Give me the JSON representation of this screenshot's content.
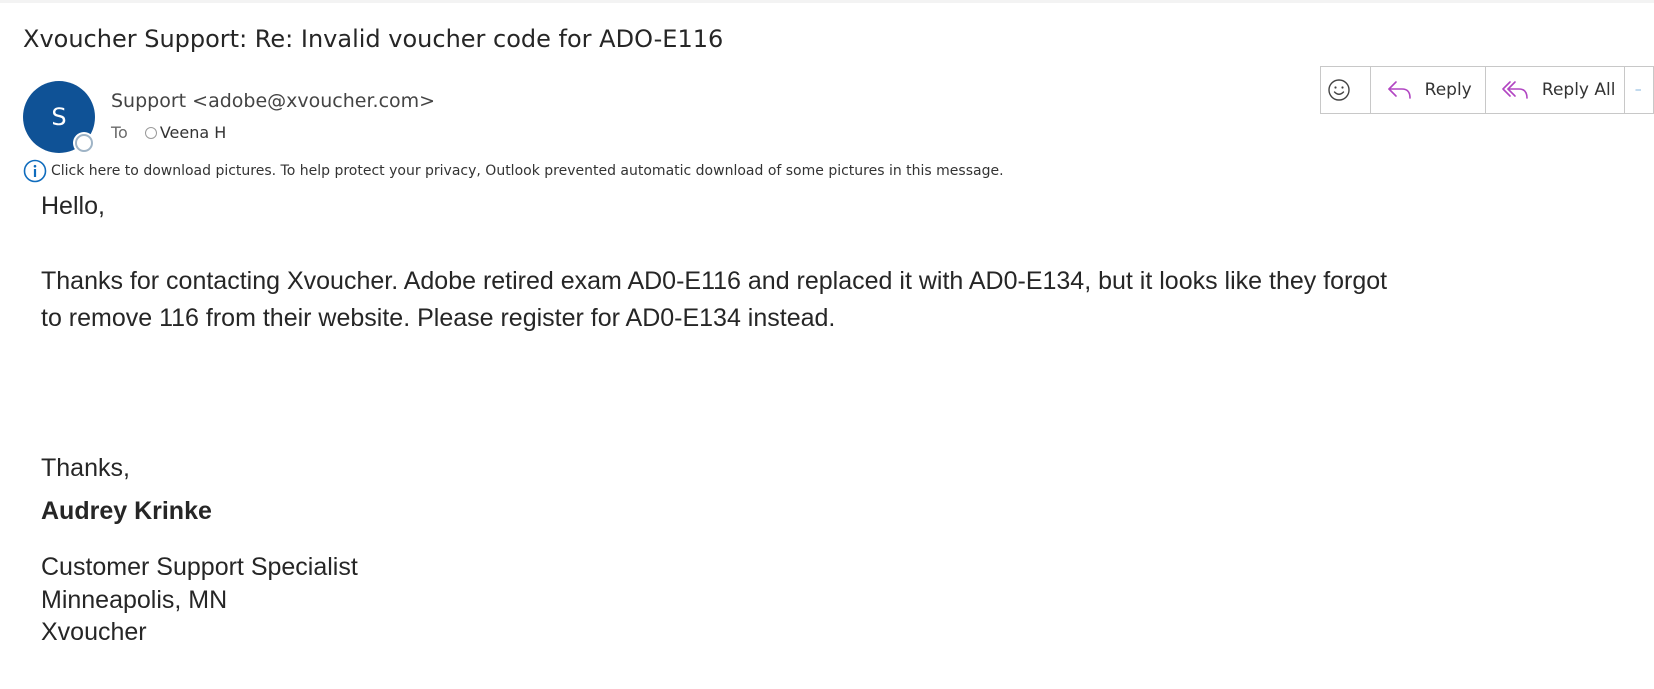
{
  "email": {
    "subject": "Xvoucher Support: Re: Invalid voucher code for ADO-E116",
    "sender": {
      "initial": "S",
      "display": "Support <adobe@xvoucher.com>"
    },
    "to_label": "To",
    "recipient": "Veena H",
    "info_bar_text": "Click here to download pictures. To help protect your privacy, Outlook prevented automatic download of some pictures in this message.",
    "actions": {
      "emoji_icon": "smiley-icon",
      "reply_label": "Reply",
      "reply_all_label": "Reply All"
    },
    "body": {
      "greeting": "Hello,",
      "paragraph_line1": "Thanks for contacting Xvoucher. Adobe retired exam AD0-E116 and replaced it with AD0-E134, but it looks like they forgot",
      "paragraph_line2": "to remove 116 from their website. Please register for AD0-E134 instead.",
      "closing": "Thanks,",
      "signature_name": "Audrey Krinke",
      "signature_title": "Customer Support Specialist",
      "signature_location": "Minneapolis, MN",
      "signature_company": "Xvoucher"
    }
  },
  "colors": {
    "avatar": "#0f5296",
    "reply_icon": "#a4373a",
    "reply_icon_accent": "#b146c2",
    "info_icon": "#0f6cbd"
  }
}
